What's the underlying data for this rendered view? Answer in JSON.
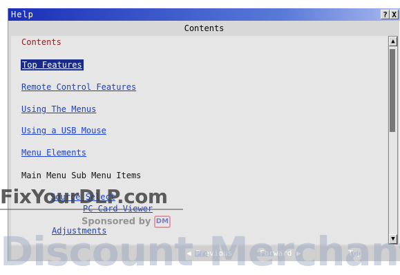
{
  "window": {
    "title": "Help",
    "help_button": "?",
    "close_button": "X",
    "subtitle": "Contents"
  },
  "content": {
    "heading": "Contents",
    "links": [
      {
        "label": "Top Features",
        "selected": true
      },
      {
        "label": "Remote Control Features"
      },
      {
        "label": "Using The Menus"
      },
      {
        "label": "Using a USB Mouse"
      },
      {
        "label": "Menu Elements"
      }
    ],
    "section_label": "Main Menu Sub Menu Items",
    "sub_links": [
      {
        "label": "Source Select"
      },
      {
        "label": "PC Card Viewer"
      },
      {
        "label": "Adjustments"
      }
    ]
  },
  "scrollbar": {
    "up_glyph": "▲",
    "down_glyph": "▼",
    "position": 0.0
  },
  "navbar": {
    "previous_label": "◀ Previous",
    "forward_label": "Forward ▶",
    "top_label": "Top"
  },
  "watermark": {
    "site_prefix": "FixYour",
    "site_brand": "DLP",
    "site_suffix": ".com",
    "sponsor_text": "Sponsored by",
    "sponsor_logo": "DM",
    "overlay_text": "Discount-Merchant"
  },
  "colors": {
    "titlebar": "#1a2fb8",
    "link": "#1a3fcc",
    "heading": "#8b1a1a",
    "selected_bg": "#1a2a8a",
    "panel": "#d8d8d8"
  }
}
